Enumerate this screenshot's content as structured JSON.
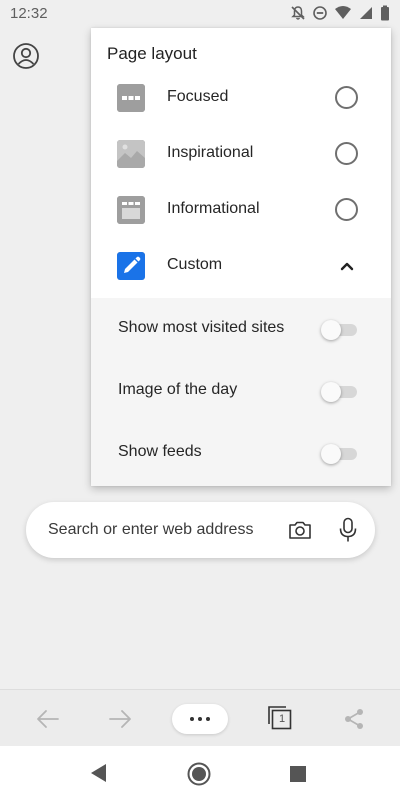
{
  "status_bar": {
    "time": "12:32",
    "icons": [
      "notifications-off-icon",
      "do-not-disturb-icon",
      "wifi-icon",
      "signal-icon",
      "battery-icon"
    ]
  },
  "header": {
    "profile_icon": "profile-icon"
  },
  "page_layout_panel": {
    "title": "Page layout",
    "options": [
      {
        "label": "Focused",
        "icon": "focused-layout-icon",
        "selected": false
      },
      {
        "label": "Inspirational",
        "icon": "inspirational-layout-icon",
        "selected": false
      },
      {
        "label": "Informational",
        "icon": "informational-layout-icon",
        "selected": false
      },
      {
        "label": "Custom",
        "icon": "custom-layout-pencil-icon",
        "expanded": true
      }
    ],
    "custom_settings": [
      {
        "label": "Show most visited sites",
        "enabled": false
      },
      {
        "label": "Image of the day",
        "enabled": false
      },
      {
        "label": "Show feeds",
        "enabled": false
      }
    ],
    "accent_color": "#1a73e8"
  },
  "search": {
    "placeholder": "Search or enter web address"
  },
  "toolbar": {
    "tabs_count": "1",
    "buttons": [
      "back-icon",
      "forward-icon",
      "more-icon",
      "tabs-icon",
      "share-icon"
    ]
  },
  "system_nav": {
    "buttons": [
      "back-triangle-icon",
      "home-circle-icon",
      "recents-square-icon"
    ]
  }
}
